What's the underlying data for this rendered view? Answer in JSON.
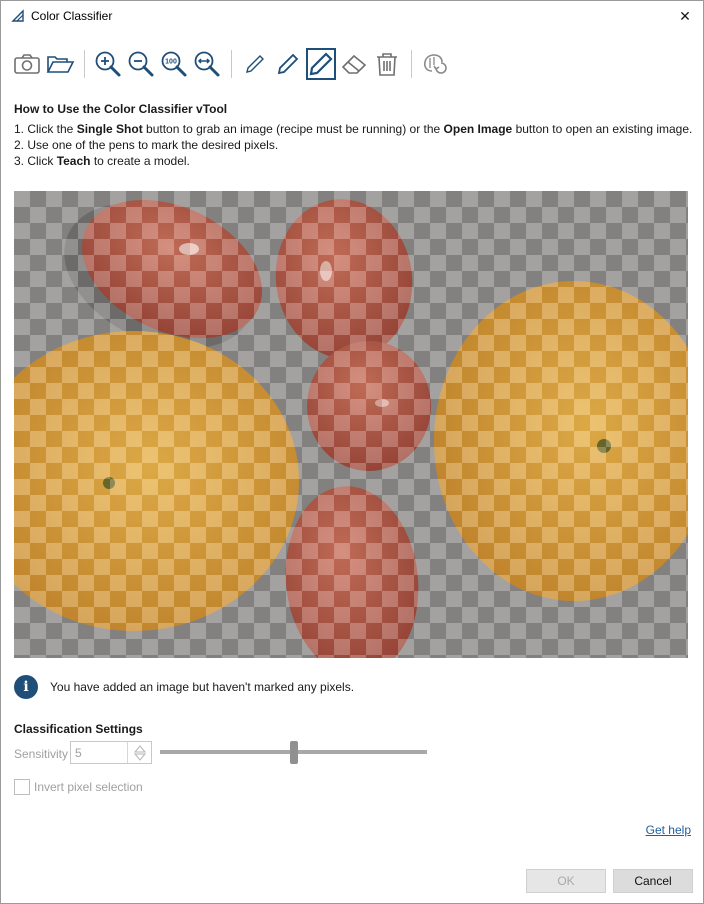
{
  "window": {
    "title": "Color Classifier",
    "close_glyph": "✕"
  },
  "toolbar": {
    "icons": [
      "camera-icon",
      "open-folder-icon",
      "zoom-in-icon",
      "zoom-out-icon",
      "zoom-100-icon",
      "zoom-fit-width-icon",
      "pen-thin-icon",
      "pen-medium-icon",
      "pen-thick-icon",
      "eraser-icon",
      "trash-icon",
      "teach-icon"
    ],
    "zoom100_text": "100",
    "active_tool": "pen-thick-icon"
  },
  "howto": {
    "title": "How to Use the Color Classifier vTool",
    "line1_prefix": "1. Click the ",
    "line1_bold1": "Single Shot",
    "line1_mid": " button to grab an image (recipe must be running) or the ",
    "line1_bold2": "Open Image",
    "line1_suffix": " button to open an existing image.",
    "line2": "2. Use one of the pens to mark the desired pixels.",
    "line3_prefix": "3. Click ",
    "line3_bold": "Teach",
    "line3_suffix": " to create a model."
  },
  "info": {
    "message": "You have added an image but haven't marked any pixels."
  },
  "settings": {
    "title": "Classification Settings",
    "sensitivity_label": "Sensitivity",
    "sensitivity_value": "5",
    "slider_level": 0.5,
    "invert_label": "Invert pixel selection",
    "invert_checked": false
  },
  "links": {
    "get_help": "Get help"
  },
  "buttons": {
    "ok": "OK",
    "cancel": "Cancel"
  },
  "colors": {
    "accent": "#1f4e79",
    "link": "#1f5f9f"
  }
}
